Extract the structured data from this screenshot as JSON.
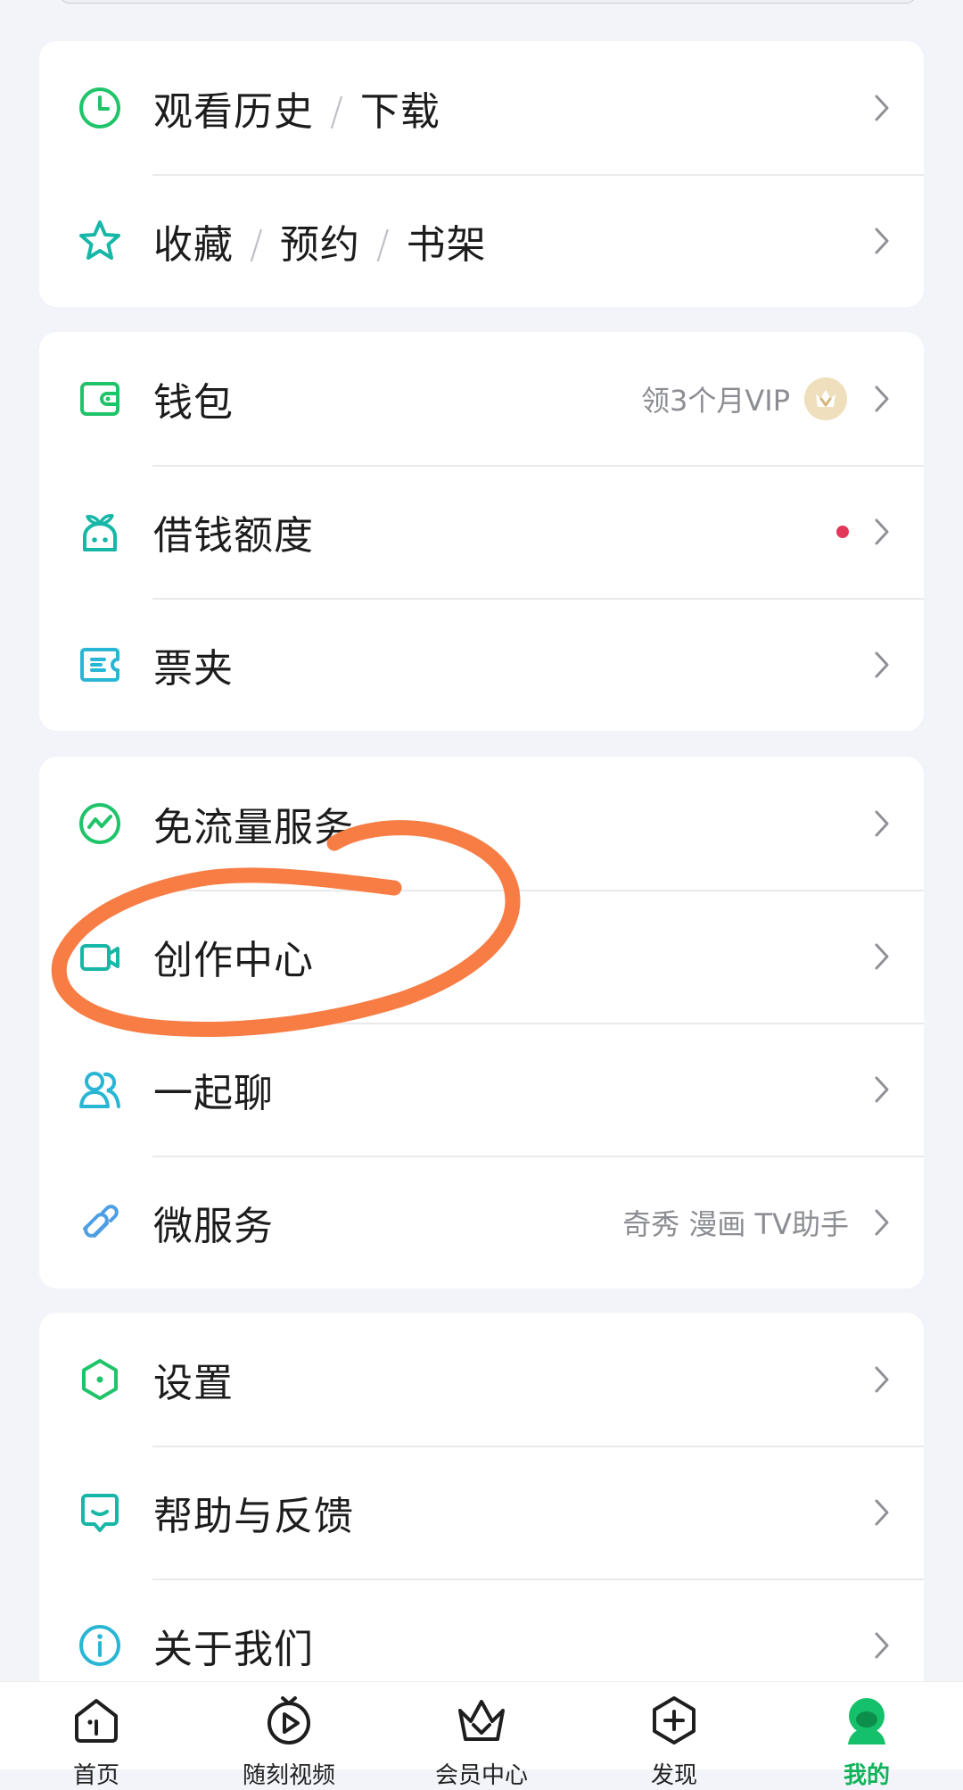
{
  "colors": {
    "accent_green": "#1fc46a",
    "teal": "#17b7a7",
    "cyan": "#29b6d4",
    "annotation_orange": "#f77d45",
    "red_dot": "#e2395a",
    "tab_active": "#11b35a"
  },
  "sections": [
    {
      "rows": [
        {
          "icon": "clock-icon",
          "label": [
            "观看历史",
            "下载"
          ],
          "sub": ""
        },
        {
          "icon": "star-icon",
          "label": [
            "收藏",
            "预约",
            "书架"
          ],
          "sub": ""
        }
      ]
    },
    {
      "rows": [
        {
          "icon": "wallet-icon",
          "label": [
            "钱包"
          ],
          "sub": "领3个月VIP",
          "badge": "vip-crown-badge"
        },
        {
          "icon": "sprout-icon",
          "label": [
            "借钱额度"
          ],
          "sub": "",
          "notification_dot": true
        },
        {
          "icon": "ticket-icon",
          "label": [
            "票夹"
          ],
          "sub": ""
        }
      ]
    },
    {
      "rows": [
        {
          "icon": "data-flow-icon",
          "label": [
            "免流量服务"
          ],
          "sub": ""
        },
        {
          "icon": "video-camera-icon",
          "label": [
            "创作中心"
          ],
          "sub": ""
        },
        {
          "icon": "people-icon",
          "label": [
            "一起聊"
          ],
          "sub": ""
        },
        {
          "icon": "link-icon",
          "label": [
            "微服务"
          ],
          "sub": "奇秀 漫画 TV助手"
        }
      ]
    },
    {
      "rows": [
        {
          "icon": "settings-hexagon-icon",
          "label": [
            "设置"
          ],
          "sub": ""
        },
        {
          "icon": "feedback-icon",
          "label": [
            "帮助与反馈"
          ],
          "sub": ""
        },
        {
          "icon": "info-icon",
          "label": [
            "关于我们"
          ],
          "sub": ""
        }
      ]
    }
  ],
  "annotation": {
    "type": "hand-drawn circle",
    "target": "创作中心"
  },
  "tabbar": {
    "tabs": [
      {
        "icon": "home-icon",
        "label": "首页",
        "active": false
      },
      {
        "icon": "play-icon",
        "label": "随刻视频",
        "active": false
      },
      {
        "icon": "vip-crown-icon",
        "label": "会员中心",
        "active": false
      },
      {
        "icon": "plus-hexagon-icon",
        "label": "发现",
        "active": false
      },
      {
        "icon": "profile-avatar-icon",
        "label": "我的",
        "active": true
      }
    ]
  }
}
